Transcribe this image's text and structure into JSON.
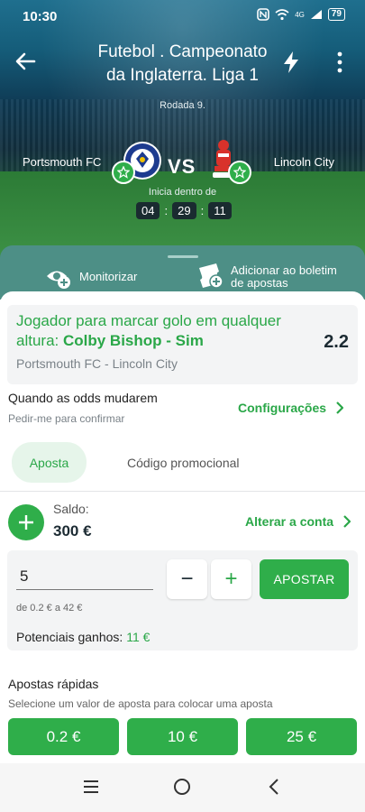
{
  "status_bar": {
    "time": "10:30",
    "network": "4G",
    "battery": "79"
  },
  "header": {
    "title_line1": "Futebol . Campeonato",
    "title_line2": "da Inglaterra. Liga 1",
    "back_icon": "arrow-left-icon",
    "bolt_icon": "lightning-icon",
    "more_icon": "more-vertical-icon"
  },
  "match": {
    "round": "Rodada 9.",
    "home_team": "Portsmouth FC",
    "away_team": "Lincoln City",
    "vs": "VS",
    "starts_in_label": "Inicia dentro de",
    "countdown": {
      "hours": "04",
      "minutes": "29",
      "seconds": "11"
    }
  },
  "actions": {
    "monitor_label": "Monitorizar",
    "add_slip_line1": "Adicionar ao boletim",
    "add_slip_line2": "de apostas"
  },
  "selection": {
    "market": "Jogador para marcar golo em qualquer altura: ",
    "pick": "Colby Bishop - Sim",
    "odds": "2.2",
    "match": "Portsmouth FC - Lincoln City"
  },
  "odds_settings": {
    "title": "Quando as odds mudarem",
    "subtitle": "Pedir-me para confirmar",
    "link": "Configurações"
  },
  "tabs": [
    {
      "label": "Aposta",
      "active": true
    },
    {
      "label": "Código promocional",
      "active": false
    }
  ],
  "balance": {
    "label": "Saldo:",
    "value": "300 €",
    "change_account": "Alterar a conta"
  },
  "stake": {
    "value": "5",
    "limits": "de 0.2 € a 42 €",
    "minus": "−",
    "plus": "+",
    "place_bet": "APOSTAR",
    "potential_label": "Potenciais ganhos: ",
    "potential_value": "11 €"
  },
  "quick_bets": {
    "title": "Apostas rápidas",
    "subtitle": "Selecione um valor de aposta para colocar uma aposta",
    "amounts": [
      "0.2 €",
      "10 €",
      "25 €"
    ]
  },
  "colors": {
    "accent": "#2fae4a",
    "drawer": "#4d8f86",
    "card_bg": "#f3f4f5"
  }
}
